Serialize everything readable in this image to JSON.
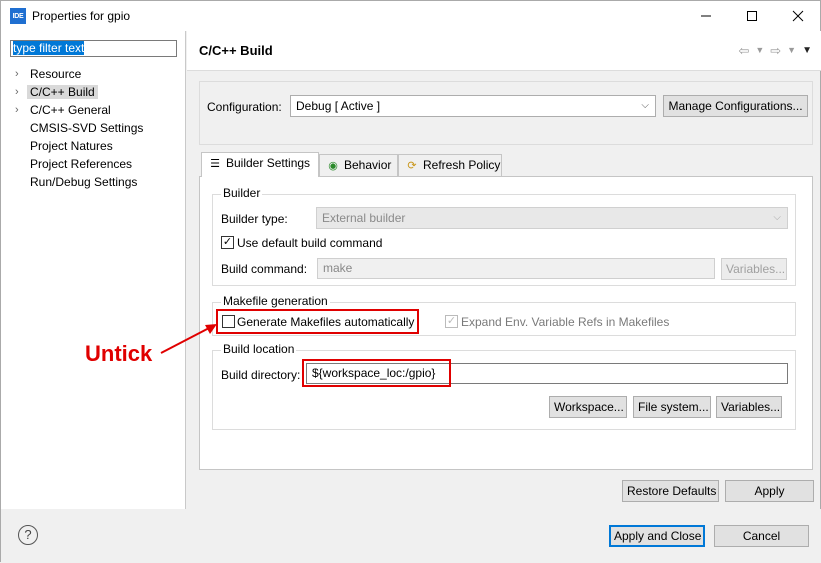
{
  "window": {
    "title": "Properties for gpio",
    "app_icon": "IDE"
  },
  "filter": {
    "value": "type filter text"
  },
  "tree": {
    "items": [
      {
        "label": "Resource",
        "expandable": true
      },
      {
        "label": "C/C++ Build",
        "expandable": true,
        "selected": true
      },
      {
        "label": "C/C++ General",
        "expandable": true
      },
      {
        "label": "CMSIS-SVD Settings",
        "expandable": false
      },
      {
        "label": "Project Natures",
        "expandable": false
      },
      {
        "label": "Project References",
        "expandable": false
      },
      {
        "label": "Run/Debug Settings",
        "expandable": false
      }
    ]
  },
  "page": {
    "title": "C/C++ Build"
  },
  "configuration": {
    "label": "Configuration:",
    "value": "Debug  [ Active ]",
    "manage_button": "Manage Configurations..."
  },
  "tabs": [
    {
      "label": "Builder Settings",
      "icon": "list-icon",
      "active": true
    },
    {
      "label": "Behavior",
      "icon": "radio-icon",
      "active": false
    },
    {
      "label": "Refresh Policy",
      "icon": "refresh-icon",
      "active": false
    }
  ],
  "builder": {
    "group_title": "Builder",
    "type_label": "Builder type:",
    "type_value": "External builder",
    "use_default_label": "Use default build command",
    "use_default_checked": true,
    "command_label": "Build command:",
    "command_value": "make",
    "variables_button": "Variables..."
  },
  "makefile": {
    "group_title": "Makefile generation",
    "generate_label": "Generate Makefiles automatically",
    "generate_checked": false,
    "expand_label": "Expand Env. Variable Refs in Makefiles",
    "expand_checked": true
  },
  "location": {
    "group_title": "Build location",
    "dir_label": "Build directory:",
    "dir_value": "${workspace_loc:/gpio}",
    "workspace_button": "Workspace...",
    "filesystem_button": "File system...",
    "variables_button": "Variables..."
  },
  "annotation": {
    "text": "Untick",
    "color": "#e00000"
  },
  "buttons": {
    "restore_defaults": "Restore Defaults",
    "apply": "Apply",
    "apply_close": "Apply and Close",
    "cancel": "Cancel"
  },
  "colors": {
    "accent": "#0078d7",
    "highlight": "#e00000"
  }
}
